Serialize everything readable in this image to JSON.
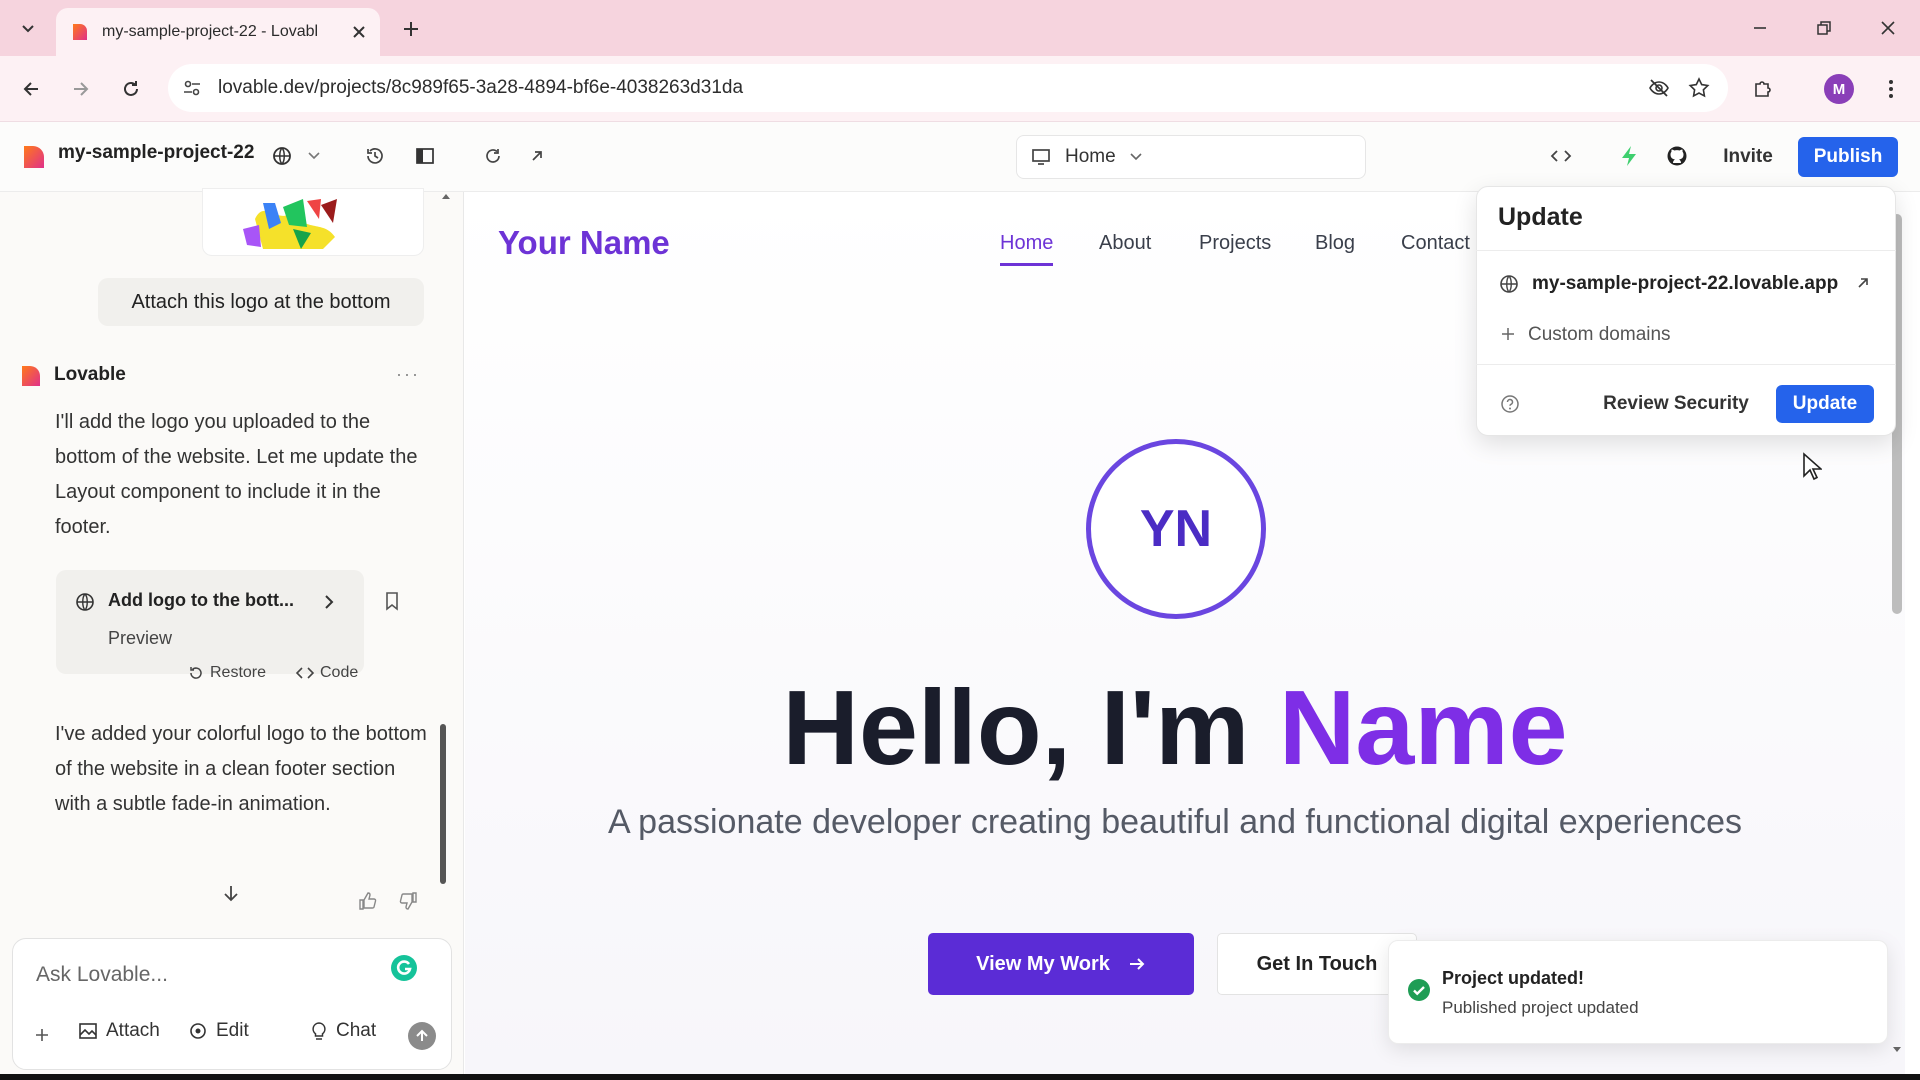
{
  "browser": {
    "tab_title": "my-sample-project-22 - Lovabl",
    "url": "lovable.dev/projects/8c989f65-3a28-4894-bf6e-4038263d31da",
    "profile_initial": "M"
  },
  "app_header": {
    "project_name": "my-sample-project-22",
    "route": "Home",
    "invite_label": "Invite",
    "publish_label": "Publish"
  },
  "chat": {
    "user_message": "Attach this logo at the bottom",
    "agent_name": "Lovable",
    "agent_message_1": "I'll add the logo you uploaded to the bottom of the website. Let me update the Layout component to include it in the footer.",
    "card_title": "Add logo to the bott...",
    "card_preview": "Preview",
    "restore_label": "Restore",
    "code_label": "Code",
    "agent_message_2": "I've added your colorful logo to the bottom of the website in a clean footer section with a subtle fade-in animation.",
    "input_placeholder": "Ask Lovable...",
    "attach_label": "Attach",
    "edit_label": "Edit",
    "chat_label": "Chat"
  },
  "preview": {
    "site_logo": "Your Name",
    "nav": [
      "Home",
      "About",
      "Projects",
      "Blog",
      "Contact"
    ],
    "avatar_initials": "YN",
    "hero_prefix": "Hello, I'm ",
    "hero_accent": "Name",
    "subtitle": "A passionate developer creating beautiful and functional digital experiences",
    "primary_button": "View My Work",
    "secondary_button": "Get In Touch"
  },
  "update_popover": {
    "title": "Update",
    "domain": "my-sample-project-22.lovable.app",
    "custom_domains": "Custom domains",
    "review_security": "Review Security",
    "update_label": "Update"
  },
  "toast": {
    "title": "Project updated!",
    "description": "Published project updated"
  },
  "colors": {
    "accent": "#6d33d6",
    "publish_blue": "#2563eb",
    "tab_strip": "#f6d4de",
    "success": "#1f9d55"
  }
}
